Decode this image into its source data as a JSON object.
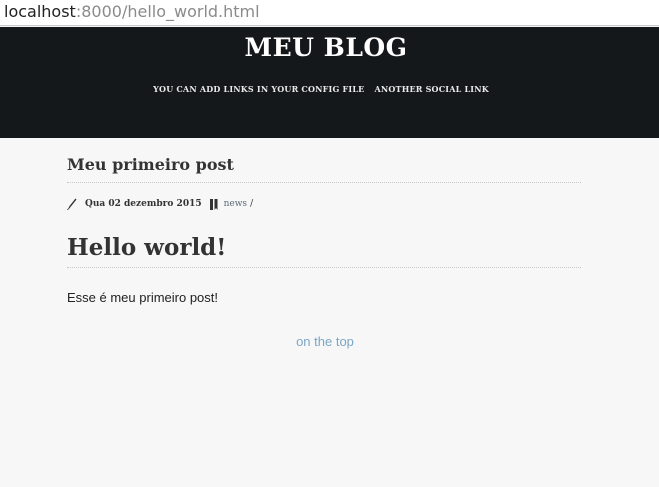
{
  "browser": {
    "url_host": "localhost",
    "url_rest": ":8000/hello_world.html"
  },
  "header": {
    "site_title": "MEU BLOG",
    "nav_links": [
      "YOU CAN ADD LINKS IN YOUR CONFIG FILE",
      "ANOTHER SOCIAL LINK"
    ]
  },
  "post": {
    "title": "Meu primeiro post",
    "meta": {
      "date_icon": "pen-icon",
      "date": "Qua 02 dezembro 2015",
      "category_icon": "bookmark-icon",
      "category": "news",
      "separator": "/"
    },
    "heading": "Hello world!",
    "body": "Esse é meu primeiro post!"
  },
  "footer": {
    "top_link": "on the top"
  },
  "colors": {
    "header_bg": "#15181b",
    "page_bg": "#f7f7f7",
    "link": "#7aa6c6",
    "category_link": "#5a6b7a"
  }
}
